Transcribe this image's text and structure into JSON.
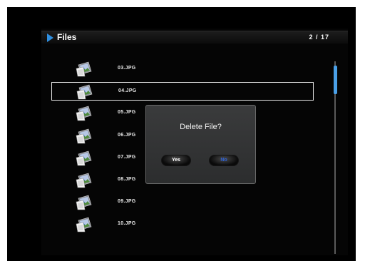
{
  "header": {
    "title": "Files",
    "page_indicator": "2 / 17"
  },
  "files": [
    {
      "name": "03.JPG"
    },
    {
      "name": "04.JPG"
    },
    {
      "name": "05.JPG"
    },
    {
      "name": "06.JPG"
    },
    {
      "name": "07.JPG"
    },
    {
      "name": "08.JPG"
    },
    {
      "name": "09.JPG"
    },
    {
      "name": "10.JPG"
    }
  ],
  "selected_index": 1,
  "dialog": {
    "message": "Delete File?",
    "yes_label": "Yes",
    "no_label": "No"
  },
  "colors": {
    "accent": "#2f8fe0",
    "no_text": "#2d5fd0"
  },
  "icons": {
    "title_marker": "play-triangle-icon",
    "file": "image-file-icon"
  }
}
